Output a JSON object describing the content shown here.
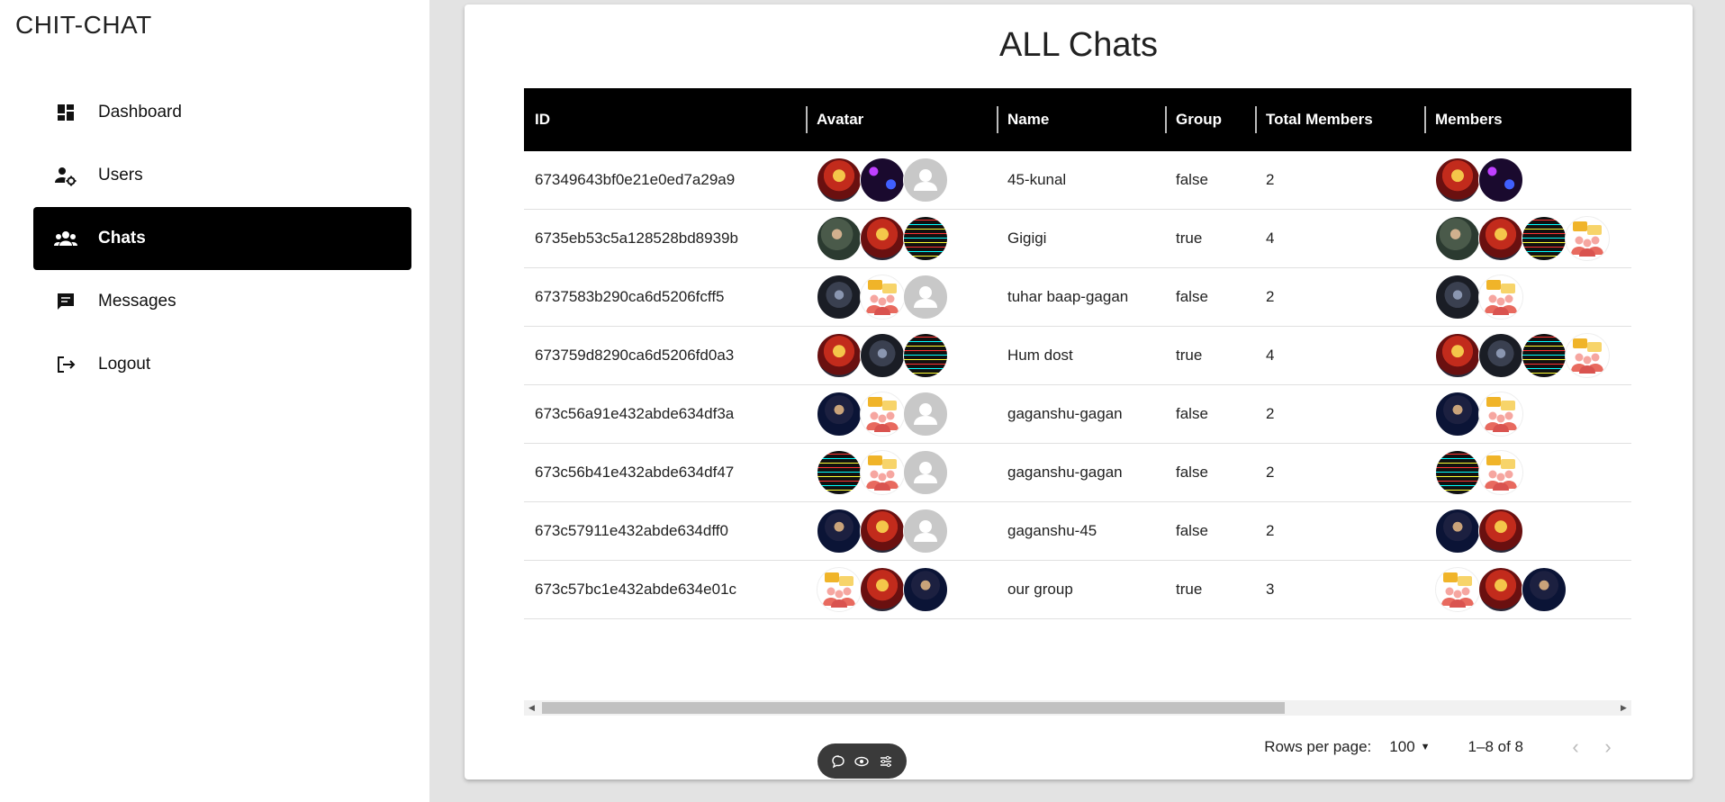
{
  "brand": "CHIT-CHAT",
  "nav": [
    {
      "label": "Dashboard",
      "icon": "dashboard-icon",
      "active": false
    },
    {
      "label": "Users",
      "icon": "user-settings-icon",
      "active": false
    },
    {
      "label": "Chats",
      "icon": "group-icon",
      "active": true
    },
    {
      "label": "Messages",
      "icon": "message-icon",
      "active": false
    },
    {
      "label": "Logout",
      "icon": "logout-icon",
      "active": false
    }
  ],
  "page_title": "ALL Chats",
  "table": {
    "columns": [
      "ID",
      "Avatar",
      "Name",
      "Group",
      "Total Members",
      "Members"
    ],
    "rows": [
      {
        "id": "67349643bf0e21e0ed7a29a9",
        "avatar": [
          "iron",
          "neon",
          "none"
        ],
        "name": "45-kunal",
        "group": "false",
        "total": "2",
        "members": [
          "iron",
          "neon"
        ]
      },
      {
        "id": "6735eb53c5a128528bd8939b",
        "avatar": [
          "photo",
          "iron",
          "code"
        ],
        "name": "Gigigi",
        "group": "true",
        "total": "4",
        "members": [
          "photo",
          "iron",
          "code",
          "group"
        ]
      },
      {
        "id": "6737583b290ca6d5206fcff5",
        "avatar": [
          "dark",
          "group",
          "none"
        ],
        "name": "tuhar baap-gagan",
        "group": "false",
        "total": "2",
        "members": [
          "dark",
          "group"
        ]
      },
      {
        "id": "673759d8290ca6d5206fd0a3",
        "avatar": [
          "iron",
          "dark",
          "code"
        ],
        "name": "Hum dost",
        "group": "true",
        "total": "4",
        "members": [
          "iron",
          "dark",
          "code",
          "group"
        ]
      },
      {
        "id": "673c56a91e432abde634df3a",
        "avatar": [
          "cyber",
          "group",
          "none"
        ],
        "name": "gaganshu-gagan",
        "group": "false",
        "total": "2",
        "members": [
          "cyber",
          "group"
        ]
      },
      {
        "id": "673c56b41e432abde634df47",
        "avatar": [
          "code",
          "group",
          "none"
        ],
        "name": "gaganshu-gagan",
        "group": "false",
        "total": "2",
        "members": [
          "code",
          "group"
        ]
      },
      {
        "id": "673c57911e432abde634dff0",
        "avatar": [
          "cyber",
          "iron",
          "none"
        ],
        "name": "gaganshu-45",
        "group": "false",
        "total": "2",
        "members": [
          "cyber",
          "iron"
        ]
      },
      {
        "id": "673c57bc1e432abde634e01c",
        "avatar": [
          "group",
          "iron",
          "cyber"
        ],
        "name": "our group",
        "group": "true",
        "total": "3",
        "members": [
          "group",
          "iron",
          "cyber"
        ]
      }
    ]
  },
  "pagination": {
    "rows_per_page_label": "Rows per page:",
    "rows_per_page_value": "100",
    "range": "1–8 of 8"
  },
  "colors": {
    "active_nav_bg": "#000000",
    "header_bg": "#000000",
    "page_bg": "#e3e3e3"
  }
}
